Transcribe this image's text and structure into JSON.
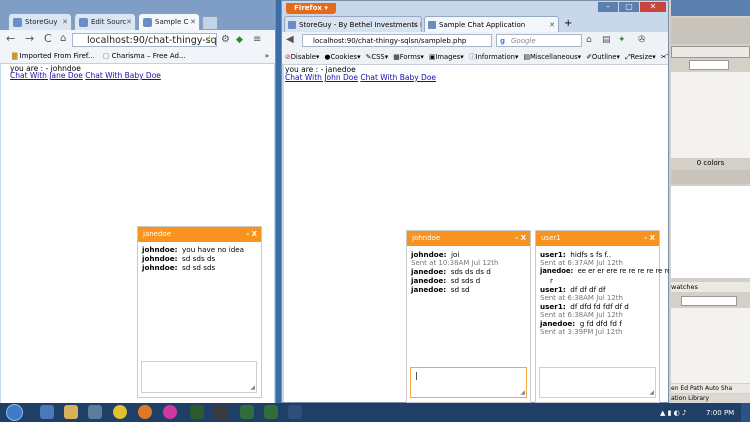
{
  "left_browser": {
    "tabs": [
      {
        "label": "StoreGuy",
        "active": false
      },
      {
        "label": "Edit Sourc",
        "active": false
      },
      {
        "label": "Sample C",
        "active": true
      }
    ],
    "url": "localhost:90/chat-thingy-sqls",
    "bookmarks": [
      "Imported From Firef...",
      "Charisma – Free Ad..."
    ],
    "bookmarks_more": "»",
    "you_are": "you are : - johndoe",
    "links": [
      "Chat With Jane Doe",
      "Chat With Baby Doe"
    ],
    "chat": {
      "title": "janedoe",
      "controls": "- X",
      "messages": [
        {
          "user": "johndoe:",
          "text": "you have no idea"
        },
        {
          "user": "johndoe:",
          "text": "sd sds ds"
        },
        {
          "user": "johndoe:",
          "text": "sd sd sds"
        }
      ]
    }
  },
  "firefox": {
    "menu_button": "Firefox",
    "tabs": [
      {
        "label": "StoreGuy - By Bethel Investments Lim...",
        "active": false
      },
      {
        "label": "Sample Chat Application",
        "active": true
      }
    ],
    "new_tab": "+",
    "url": "localhost:90/chat-thingy-sqlsn/sampleb.php",
    "search_placeholder": "Google",
    "devbar": [
      "Disable",
      "Cookies",
      "CSS",
      "Forms",
      "Images",
      "Information",
      "Miscellaneous",
      "Outline",
      "Resize",
      "T"
    ],
    "you_are": "you are : - janedoe",
    "links": [
      "Chat With John Doe",
      "Chat With Baby Doe"
    ],
    "chat_johndoe": {
      "title": "johndoe",
      "controls": "- X",
      "entries": [
        {
          "user": "johndoe:",
          "text": "joi",
          "sent": "Sent at 10:38AM Jul 12th"
        },
        {
          "user": "janedoe:",
          "text": "sds ds ds d",
          "sent": ""
        },
        {
          "user": "janedoe:",
          "text": "sd sds d",
          "sent": ""
        },
        {
          "user": "janedoe:",
          "text": "sd sd",
          "sent": ""
        }
      ]
    },
    "chat_user1": {
      "title": "user1",
      "controls": "- X",
      "entries": [
        {
          "user": "user1:",
          "text": "hidfs s fs f..",
          "sent": "Sent at 6:37AM Jul 12th"
        },
        {
          "user": "janedoe:",
          "text": "ee er er ere re re re re re re",
          "extra": "r",
          "sent": ""
        },
        {
          "user": "user1:",
          "text": "df df df df",
          "sent": "Sent at 6:38AM Jul 12th"
        },
        {
          "user": "user1:",
          "text": "df dfd fd fdf df d",
          "sent": "Sent at 6:38AM Jul 12th"
        },
        {
          "user": "janedoe:",
          "text": "g fd dfd fd f",
          "sent": "Sent at 3:39PM Jul 12th"
        }
      ]
    }
  },
  "right_panel": {
    "colors_label": "0 colors",
    "swatches_label": "watches",
    "tabs": [
      "en Ed",
      "Path",
      "Auto Sha"
    ],
    "library_label": "ation Library"
  },
  "taskbar": {
    "clock": "7:00 PM"
  },
  "colors": {
    "chat_header": "#f7931e",
    "link": "#1a0dab",
    "firefox_orange": "#e66b18",
    "taskbar": "#1f3f66"
  }
}
